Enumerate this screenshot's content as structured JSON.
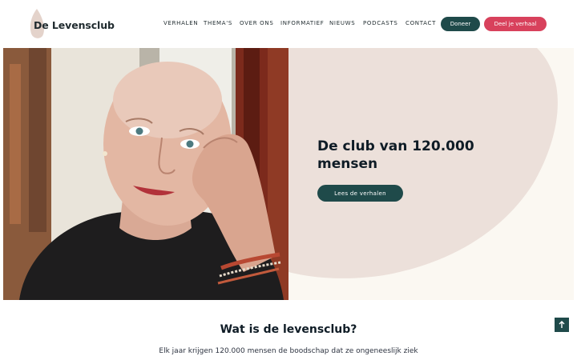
{
  "header": {
    "logo_text": "De Levensclub",
    "nav": [
      {
        "label": "VERHALEN"
      },
      {
        "label": "THEMA'S"
      },
      {
        "label": "OVER ONS"
      },
      {
        "label": "INFORMATIEF"
      },
      {
        "label": "NIEUWS"
      },
      {
        "label": "PODCASTS"
      },
      {
        "label": "CONTACT"
      }
    ],
    "donate_label": "Doneer",
    "share_label": "Deel je verhaal"
  },
  "hero": {
    "title": "De club van 120.000 mensen",
    "cta_label": "Lees de verhalen"
  },
  "about": {
    "title": "Wat is de levensclub?",
    "text": "Elk jaar krijgen 120.000 mensen de boodschap dat ze ongeneeslijk ziek"
  },
  "icons": {
    "to_top": "arrow-up-icon"
  },
  "colors": {
    "primary": "#1f4a4a",
    "accent": "#d8415c",
    "blob": "#ece0da",
    "hero_bg": "#fbf8f2"
  }
}
